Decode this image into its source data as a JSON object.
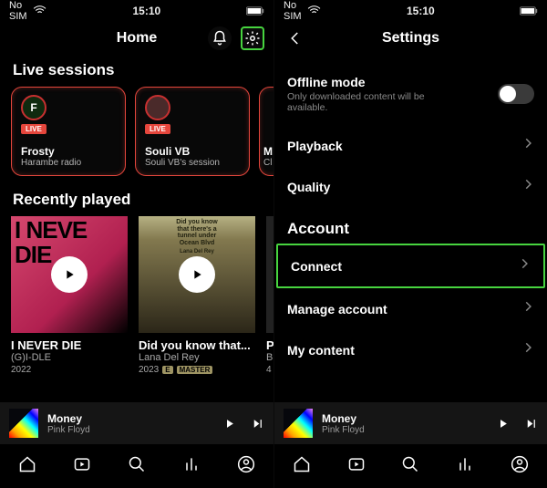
{
  "left": {
    "status": {
      "carrier": "No SIM",
      "time": "15:10"
    },
    "header": {
      "title": "Home"
    },
    "live": {
      "section": "Live sessions",
      "cards": [
        {
          "initial": "F",
          "badge": "LIVE",
          "name": "Frosty",
          "sub": "Harambe radio"
        },
        {
          "initial": "",
          "badge": "LIVE",
          "name": "Souli VB",
          "sub": "Souli VB's session"
        },
        {
          "initial": "",
          "badge": "",
          "name": "M",
          "sub": "Cl"
        }
      ]
    },
    "recent": {
      "section": "Recently played",
      "items": [
        {
          "cover_text_top": "I NEVE",
          "cover_text_bot": "DIE",
          "title": "I NEVER DIE",
          "artist": "(G)I-DLE",
          "year": "2022"
        },
        {
          "cover_line1": "Did you know",
          "cover_line2": "that there's a",
          "cover_line3": "tunnel under",
          "cover_line4": "Ocean Blvd",
          "cover_artist": "Lana Del Rey",
          "title": "Did you know that...",
          "artist": "Lana Del Rey",
          "year": "2023",
          "tag_e": "E",
          "tag_m": "MASTER"
        },
        {
          "title": "P",
          "artist": "B",
          "year": "4"
        }
      ]
    },
    "now_playing": {
      "title": "Money",
      "artist": "Pink Floyd"
    }
  },
  "right": {
    "status": {
      "carrier": "No SIM",
      "time": "15:10"
    },
    "header": {
      "title": "Settings"
    },
    "rows": {
      "offline_title": "Offline mode",
      "offline_sub": "Only downloaded content will be available.",
      "playback": "Playback",
      "quality": "Quality",
      "account_head": "Account",
      "connect": "Connect",
      "manage": "Manage account",
      "mycontent": "My content"
    },
    "now_playing": {
      "title": "Money",
      "artist": "Pink Floyd"
    }
  }
}
